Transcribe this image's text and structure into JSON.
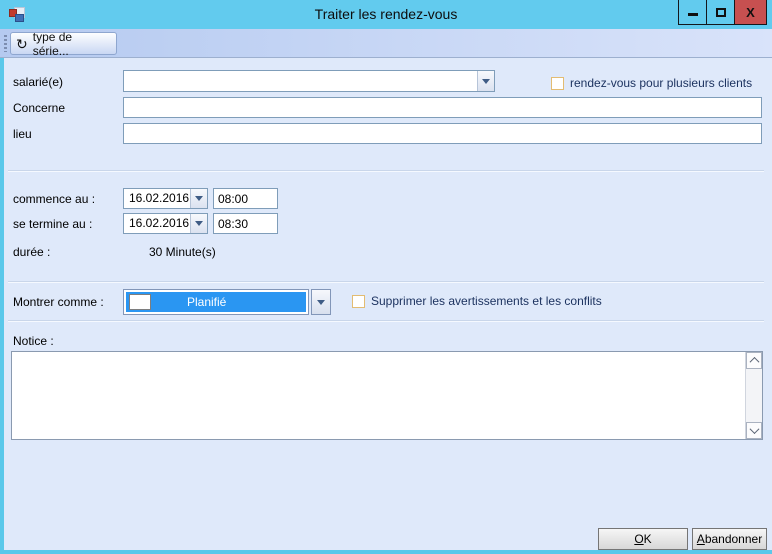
{
  "window": {
    "title": "Traiter les rendez-vous",
    "close_glyph": "X"
  },
  "toolbar": {
    "series_button_label": "type de série...",
    "series_icon_glyph": "↻"
  },
  "form": {
    "salarie_label": "salarié(e)",
    "salarie_value": "",
    "multi_clients_checkbox_label": "rendez-vous pour plusieurs clients",
    "concerne_label": "Concerne",
    "concerne_value": "",
    "lieu_label": "lieu",
    "lieu_value": "",
    "commence_label": "commence au :",
    "commence_date": "16.02.2016",
    "commence_time": "08:00",
    "termine_label": "se termine au :",
    "termine_date": "16.02.2016",
    "termine_time": "08:30",
    "duree_label": "durée :",
    "duree_value": "30 Minute(s)",
    "montrer_label": "Montrer comme :",
    "montrer_value": "Planifié",
    "supprimer_checkbox_label": "Supprimer les avertissements et les conflits",
    "notice_label": "Notice :",
    "notice_value": ""
  },
  "footer": {
    "ok_accel": "O",
    "ok_rest": "K",
    "cancel_accel": "A",
    "cancel_rest": "bandonner"
  },
  "colors": {
    "titlebar": "#62cbee",
    "close_button": "#c75050",
    "toolbar": "#b5caf0",
    "content_background": "#dfe9fa",
    "window_border": "#5ac8ea",
    "selection_highlight": "#2a96f2",
    "checkbox_border": "#e3bc72"
  }
}
